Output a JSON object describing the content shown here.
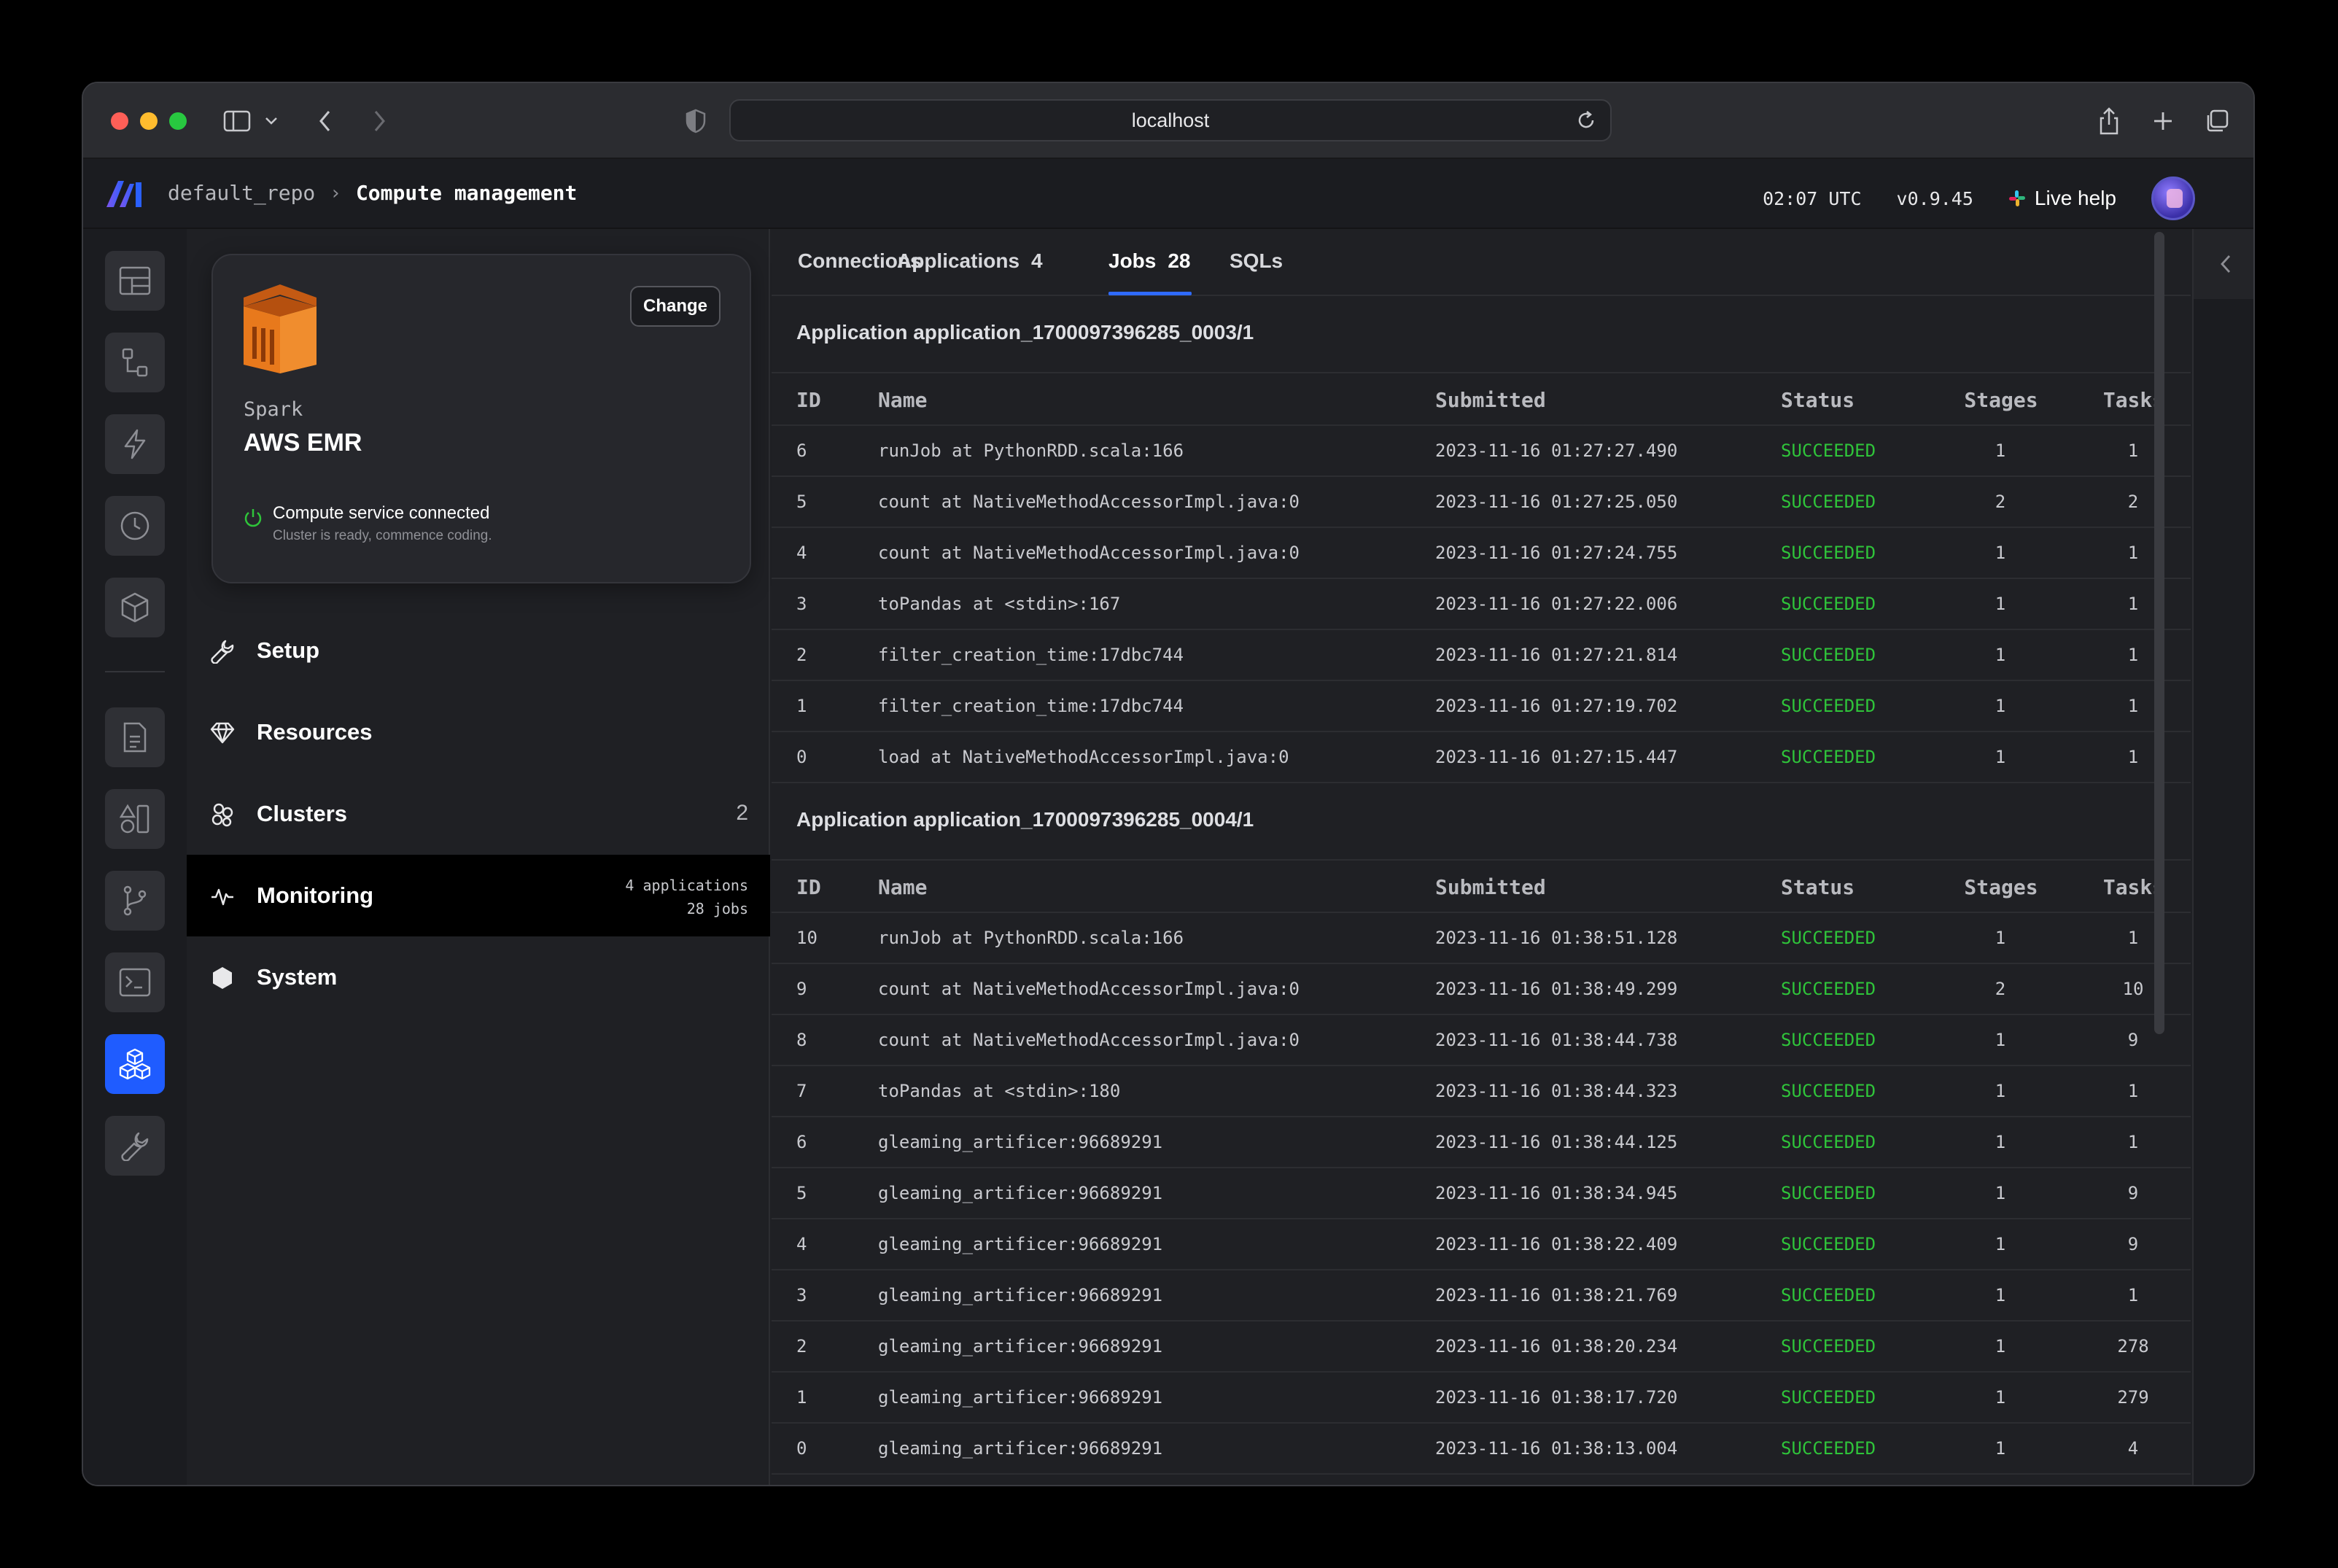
{
  "browser": {
    "url": "localhost"
  },
  "header": {
    "repo": "default_repo",
    "page": "Compute management",
    "time": "02:07 UTC",
    "version": "v0.9.45",
    "live_help": "Live help"
  },
  "compute_card": {
    "subtitle": "Spark",
    "title": "AWS EMR",
    "change_label": "Change",
    "status_main": "Compute service connected",
    "status_sub": "Cluster is ready, commence coding."
  },
  "nav": {
    "setup": "Setup",
    "resources": "Resources",
    "clusters": "Clusters",
    "clusters_count": "2",
    "monitoring": "Monitoring",
    "monitoring_apps": "4 applications",
    "monitoring_jobs": "28 jobs",
    "system": "System"
  },
  "tabs": {
    "connections": "Connections",
    "applications": "Applications",
    "applications_count": "4",
    "jobs": "Jobs",
    "jobs_count": "28",
    "sqls": "SQLs"
  },
  "columns": {
    "id": "ID",
    "name": "Name",
    "submitted": "Submitted",
    "status": "Status",
    "stages": "Stages",
    "tasks": "Tasks"
  },
  "applications": [
    {
      "title": "Application application_1700097396285_0003/1",
      "jobs": [
        {
          "id": "6",
          "name": "runJob at PythonRDD.scala:166",
          "submitted": "2023-11-16 01:27:27.490",
          "status": "SUCCEEDED",
          "stages": "1",
          "tasks": "1"
        },
        {
          "id": "5",
          "name": "count at NativeMethodAccessorImpl.java:0",
          "submitted": "2023-11-16 01:27:25.050",
          "status": "SUCCEEDED",
          "stages": "2",
          "tasks": "2"
        },
        {
          "id": "4",
          "name": "count at NativeMethodAccessorImpl.java:0",
          "submitted": "2023-11-16 01:27:24.755",
          "status": "SUCCEEDED",
          "stages": "1",
          "tasks": "1"
        },
        {
          "id": "3",
          "name": "toPandas at <stdin>:167",
          "submitted": "2023-11-16 01:27:22.006",
          "status": "SUCCEEDED",
          "stages": "1",
          "tasks": "1"
        },
        {
          "id": "2",
          "name": "filter_creation_time:17dbc744",
          "submitted": "2023-11-16 01:27:21.814",
          "status": "SUCCEEDED",
          "stages": "1",
          "tasks": "1"
        },
        {
          "id": "1",
          "name": "filter_creation_time:17dbc744",
          "submitted": "2023-11-16 01:27:19.702",
          "status": "SUCCEEDED",
          "stages": "1",
          "tasks": "1"
        },
        {
          "id": "0",
          "name": "load at NativeMethodAccessorImpl.java:0",
          "submitted": "2023-11-16 01:27:15.447",
          "status": "SUCCEEDED",
          "stages": "1",
          "tasks": "1"
        }
      ]
    },
    {
      "title": "Application application_1700097396285_0004/1",
      "jobs": [
        {
          "id": "10",
          "name": "runJob at PythonRDD.scala:166",
          "submitted": "2023-11-16 01:38:51.128",
          "status": "SUCCEEDED",
          "stages": "1",
          "tasks": "1"
        },
        {
          "id": "9",
          "name": "count at NativeMethodAccessorImpl.java:0",
          "submitted": "2023-11-16 01:38:49.299",
          "status": "SUCCEEDED",
          "stages": "2",
          "tasks": "10"
        },
        {
          "id": "8",
          "name": "count at NativeMethodAccessorImpl.java:0",
          "submitted": "2023-11-16 01:38:44.738",
          "status": "SUCCEEDED",
          "stages": "1",
          "tasks": "9"
        },
        {
          "id": "7",
          "name": "toPandas at <stdin>:180",
          "submitted": "2023-11-16 01:38:44.323",
          "status": "SUCCEEDED",
          "stages": "1",
          "tasks": "1"
        },
        {
          "id": "6",
          "name": "gleaming_artificer:96689291",
          "submitted": "2023-11-16 01:38:44.125",
          "status": "SUCCEEDED",
          "stages": "1",
          "tasks": "1"
        },
        {
          "id": "5",
          "name": "gleaming_artificer:96689291",
          "submitted": "2023-11-16 01:38:34.945",
          "status": "SUCCEEDED",
          "stages": "1",
          "tasks": "9"
        },
        {
          "id": "4",
          "name": "gleaming_artificer:96689291",
          "submitted": "2023-11-16 01:38:22.409",
          "status": "SUCCEEDED",
          "stages": "1",
          "tasks": "9"
        },
        {
          "id": "3",
          "name": "gleaming_artificer:96689291",
          "submitted": "2023-11-16 01:38:21.769",
          "status": "SUCCEEDED",
          "stages": "1",
          "tasks": "1"
        },
        {
          "id": "2",
          "name": "gleaming_artificer:96689291",
          "submitted": "2023-11-16 01:38:20.234",
          "status": "SUCCEEDED",
          "stages": "1",
          "tasks": "278"
        },
        {
          "id": "1",
          "name": "gleaming_artificer:96689291",
          "submitted": "2023-11-16 01:38:17.720",
          "status": "SUCCEEDED",
          "stages": "1",
          "tasks": "279"
        },
        {
          "id": "0",
          "name": "gleaming_artificer:96689291",
          "submitted": "2023-11-16 01:38:13.004",
          "status": "SUCCEEDED",
          "stages": "1",
          "tasks": "4"
        }
      ]
    }
  ],
  "colors": {
    "accent": "#1f5cff",
    "success": "#2fc43a",
    "aws_orange": "#e8791c"
  }
}
